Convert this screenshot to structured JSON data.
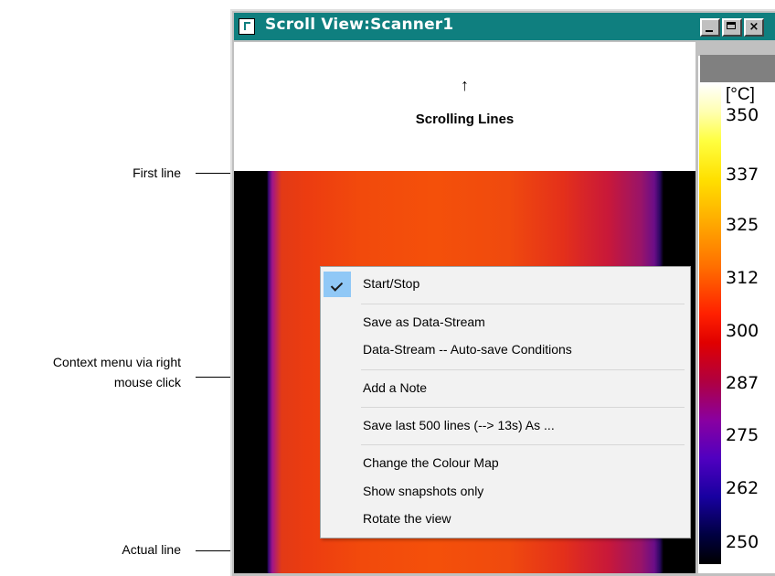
{
  "annotations": {
    "first_line": "First line",
    "context_menu_line1": "Context menu via right",
    "context_menu_line2": "mouse click",
    "actual_line": "Actual line"
  },
  "window": {
    "title": "Scroll View:Scanner1",
    "buttons": [
      "minimize-icon",
      "maximize-icon",
      "close-icon"
    ],
    "close_glyph": "×",
    "titlebar_color": "#0f7f7f"
  },
  "view": {
    "scroll_arrow": "↑",
    "scroll_label": "Scrolling Lines"
  },
  "scale": {
    "unit": "[°C]",
    "ticks": [
      "350",
      "337",
      "325",
      "312",
      "300",
      "287",
      "275",
      "262",
      "250"
    ]
  },
  "context_menu": {
    "items": [
      {
        "label": "Start/Stop",
        "checked": true
      },
      {
        "label": "Save as Data-Stream"
      },
      {
        "label": "Data-Stream -- Auto-save Conditions"
      },
      {
        "label": "Add a Note"
      },
      {
        "label": "Save last 500 lines (--> 13s) As ..."
      },
      {
        "label": "Change the Colour Map"
      },
      {
        "label": "Show snapshots only"
      },
      {
        "label": "Rotate the view"
      }
    ]
  }
}
